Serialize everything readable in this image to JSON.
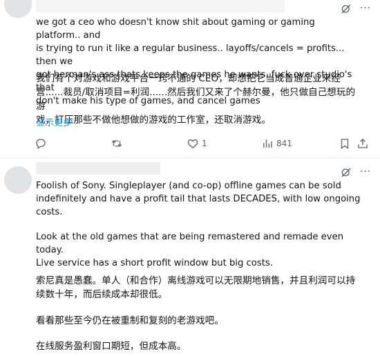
{
  "post1": {
    "text_en": "we got a ceo who doesn't know shit about gaming or gaming platform.. and\nis trying to run it like a regular business.. layoffs/cancels = profits...  then we\ngot herman's ass thats keeps the games he wants, fuck over studio's that\ndon't make his type of games, and cancel games",
    "text_zh": "我们有个对游戏和游戏平台一窍不通的 CEO，却想把它当成普通企业来经\n营......裁员/取消项目=利润......然后我们又来了个赫尔曼，他只做自己想玩的游\n戏，打压那些不做他想做的游戏的工作室，还取消游戏。",
    "show_more": "显示更多",
    "actions": {
      "reply_count": "",
      "repost_count": "",
      "like_count": "1",
      "view_count": "841"
    }
  },
  "post2": {
    "paragraphs": [
      "Foolish of Sony. Singleplayer (and co-op) offline games can be sold\nindefinitely and have a profit tail that lasts DECADES, with low ongoing\ncosts.",
      "Look at the old games that are being remastered and remade even today.",
      "Live service has a short profit window but big costs.",
      "索尼真是愚蠢。单人（和合作）离线游戏可以无限期地销售，并且利润可以持\n续数十年，而后续成本却很低。",
      "看看那些至今仍在被重制和复刻的老游戏吧。",
      "在线服务盈利窗口期短，但成本高。"
    ]
  },
  "icons": {
    "grok": "grok-icon",
    "more": "more-icon",
    "reply": "reply-icon",
    "repost": "repost-icon",
    "like": "heart-icon",
    "views": "views-icon",
    "bookmark": "bookmark-icon",
    "share": "share-icon"
  },
  "colors": {
    "text": "#0f1419",
    "secondary": "#536471",
    "link": "#1d9bf0",
    "divider": "#eff3f4"
  }
}
